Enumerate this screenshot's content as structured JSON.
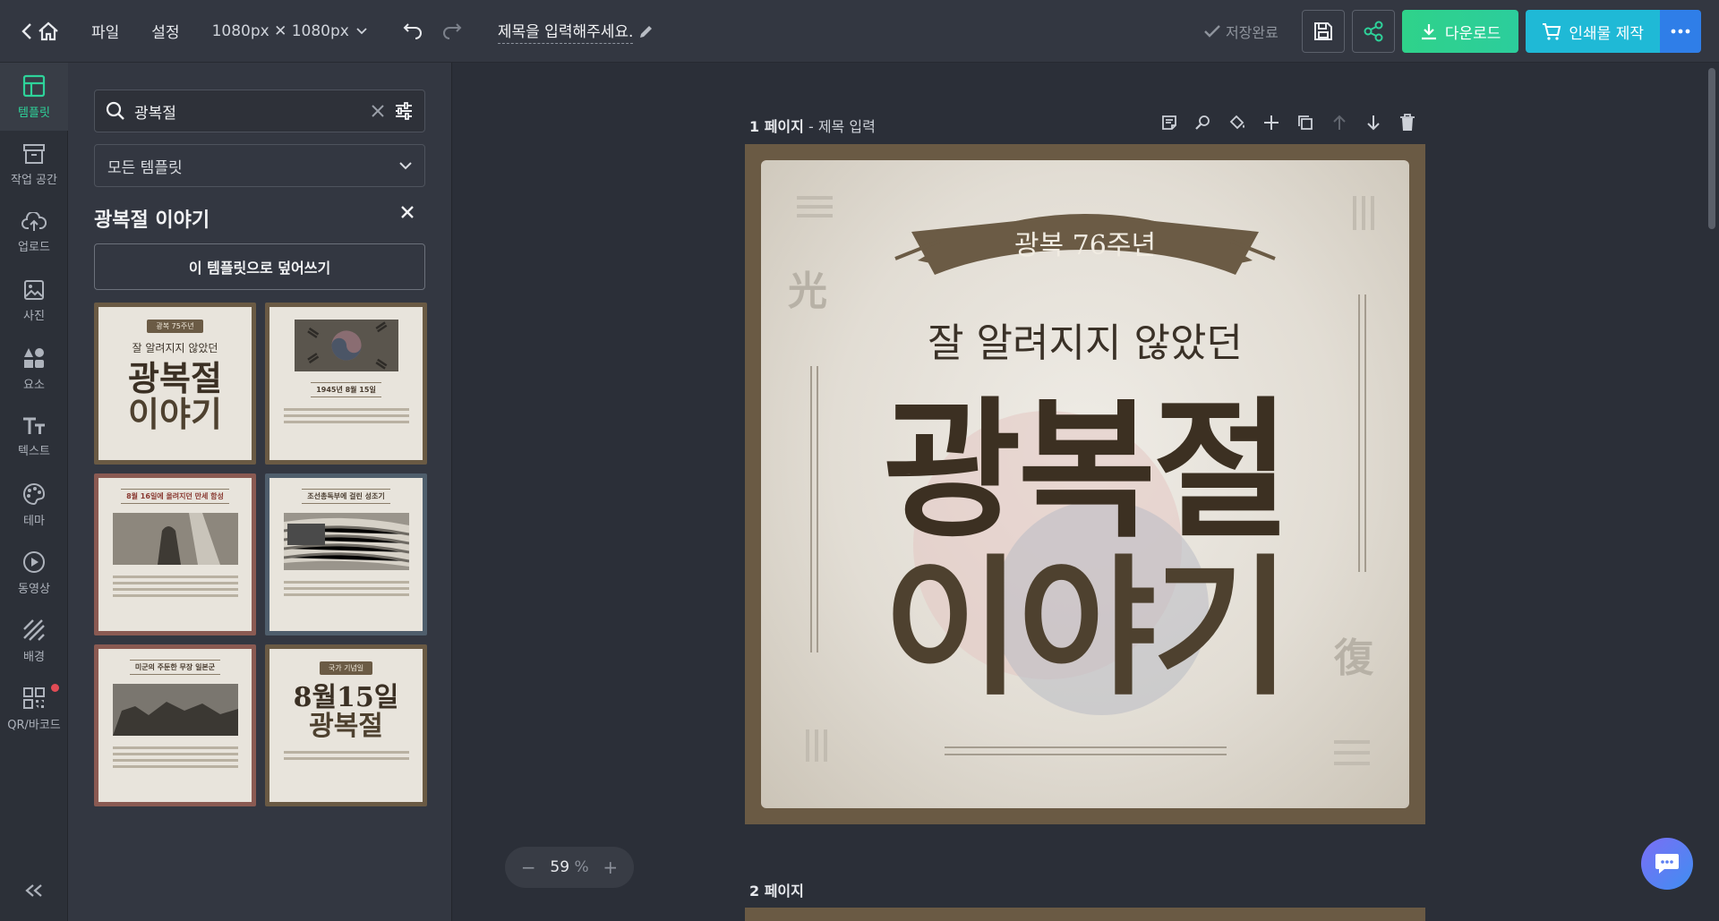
{
  "topbar": {
    "menu_file": "파일",
    "menu_settings": "설정",
    "canvas_size": "1080px ✕ 1080px",
    "title_placeholder": "제목을 입력해주세요.",
    "save_status": "저장완료",
    "download_label": "다운로드",
    "print_label": "인쇄물 제작"
  },
  "rail": {
    "items": [
      {
        "label": "템플릿",
        "icon": "template-icon"
      },
      {
        "label": "작업 공간",
        "icon": "workspace-icon"
      },
      {
        "label": "업로드",
        "icon": "upload-icon"
      },
      {
        "label": "사진",
        "icon": "photo-icon"
      },
      {
        "label": "요소",
        "icon": "elements-icon"
      },
      {
        "label": "텍스트",
        "icon": "text-icon"
      },
      {
        "label": "테마",
        "icon": "theme-icon"
      },
      {
        "label": "동영상",
        "icon": "video-icon"
      },
      {
        "label": "배경",
        "icon": "background-icon"
      },
      {
        "label": "QR/바코드",
        "icon": "qr-icon"
      }
    ]
  },
  "panel": {
    "search_value": "광복절",
    "filter_value": "모든 템플릿",
    "title": "광복절 이야기",
    "overwrite_label": "이 템플릿으로 덮어쓰기",
    "thumbnails": [
      {
        "ribbon": "광복 75주년",
        "sub": "잘 알려지지 않았던",
        "big1": "광복절",
        "big2": "이야기"
      },
      {
        "head": "1945년 8월 15일"
      },
      {
        "head": "8월 16일에 올려지던 만세 함성"
      },
      {
        "head": "조선총독부에 걸린 성조기"
      },
      {
        "head": "미군의 주둔한 무장 일본군"
      },
      {
        "ribbon": "국가 기념일",
        "big1": "8월15일",
        "big2": "광복절"
      }
    ]
  },
  "canvas": {
    "page1_label": "1 페이지",
    "page1_sep": " - ",
    "page1_title": "제목 입력",
    "ribbon_text": "광복 76주년",
    "subtitle": "잘 알려지지 않았던",
    "big1": "광복절",
    "big2": "이야기",
    "hanja_left": "光",
    "hanja_right": "復",
    "page2_label": "2 페이지",
    "zoom_value": "59",
    "zoom_unit": "%",
    "zoom_minus": "−",
    "zoom_plus": "+"
  },
  "colors": {
    "accent_green": "#2ed39a",
    "download_green": "#2fd28a",
    "print_teal": "#1fb9d6",
    "more_blue": "#2f7ee8",
    "frame_brown": "#6a5a44"
  }
}
